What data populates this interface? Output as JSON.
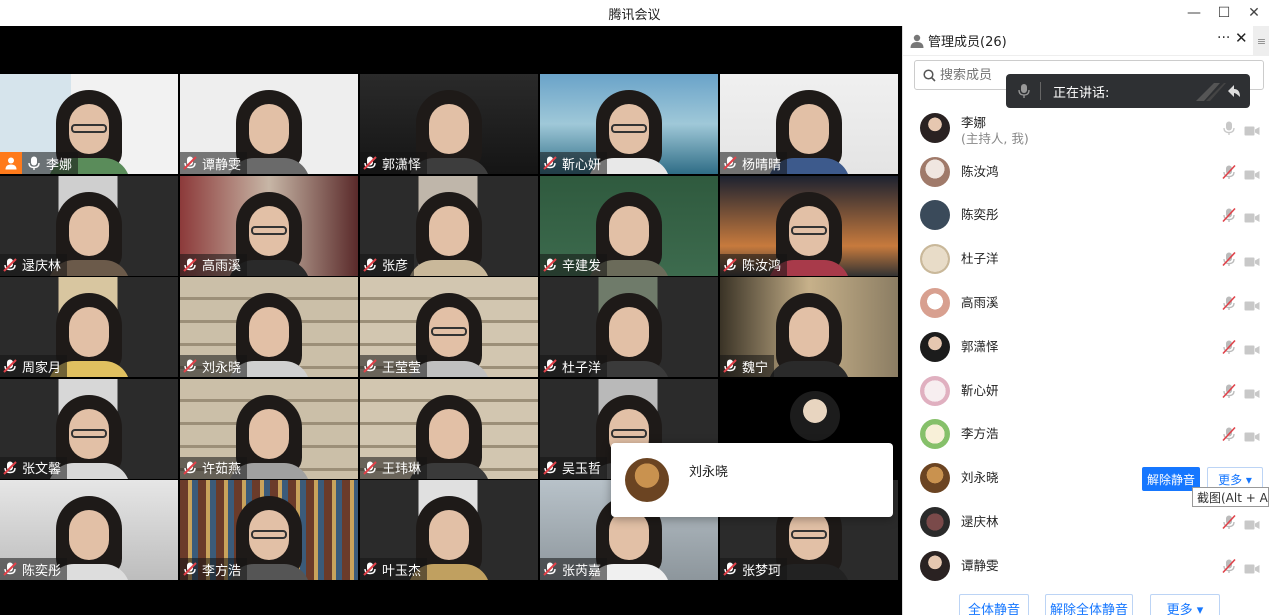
{
  "window": {
    "title": "腾讯会议",
    "minimize": "—",
    "maximize": "☐",
    "close": "✕"
  },
  "speaking": {
    "label": "正在讲话:"
  },
  "tiles": [
    {
      "name": "李娜",
      "host": true
    },
    {
      "name": "谭静雯"
    },
    {
      "name": "郭潇怿"
    },
    {
      "name": "靳心妍"
    },
    {
      "name": "杨晴晴"
    },
    {
      "name": "逯庆林"
    },
    {
      "name": "高雨溪"
    },
    {
      "name": "张彦"
    },
    {
      "name": "辛建发"
    },
    {
      "name": "陈汝鸿"
    },
    {
      "name": "周家月"
    },
    {
      "name": "刘永晓"
    },
    {
      "name": "王莹莹"
    },
    {
      "name": "杜子洋"
    },
    {
      "name": "魏宁"
    },
    {
      "name": "张文馨"
    },
    {
      "name": "许茹燕"
    },
    {
      "name": "王玮琳"
    },
    {
      "name": "吴玉哲"
    },
    {
      "name": ""
    },
    {
      "name": "陈奕彤"
    },
    {
      "name": "李方浩"
    },
    {
      "name": "叶玉杰"
    },
    {
      "name": "张芮嘉"
    },
    {
      "name": "张梦珂"
    }
  ],
  "hover_card": {
    "name": "刘永晓"
  },
  "panel": {
    "title": "管理成员(26)",
    "more": "···",
    "close": "✕",
    "search_placeholder": "搜索成员",
    "members": [
      {
        "name": "李娜",
        "sub": "(主持人, 我)",
        "muted": false
      },
      {
        "name": "陈汝鸿",
        "muted": true
      },
      {
        "name": "陈奕彤",
        "muted": true
      },
      {
        "name": "杜子洋",
        "muted": true
      },
      {
        "name": "高雨溪",
        "muted": true
      },
      {
        "name": "郭潇怿",
        "muted": true
      },
      {
        "name": "靳心妍",
        "muted": true
      },
      {
        "name": "李方浩",
        "muted": true
      },
      {
        "name": "刘永晓",
        "muted": true,
        "hovered": true
      },
      {
        "name": "逯庆林",
        "muted": true
      },
      {
        "name": "谭静雯",
        "muted": true
      }
    ],
    "unmute_label": "解除静音",
    "more_label": "更多 ▾",
    "tooltip": "截图(Alt + A)",
    "footer": {
      "mute_all": "全体静音",
      "unmute_all": "解除全体静音",
      "more": "更多 ▾"
    }
  },
  "colors": {
    "accent": "#1677ff",
    "host_badge": "#ff7a1a",
    "video_bg": "#000000",
    "toast_bg": "#2e3033"
  }
}
